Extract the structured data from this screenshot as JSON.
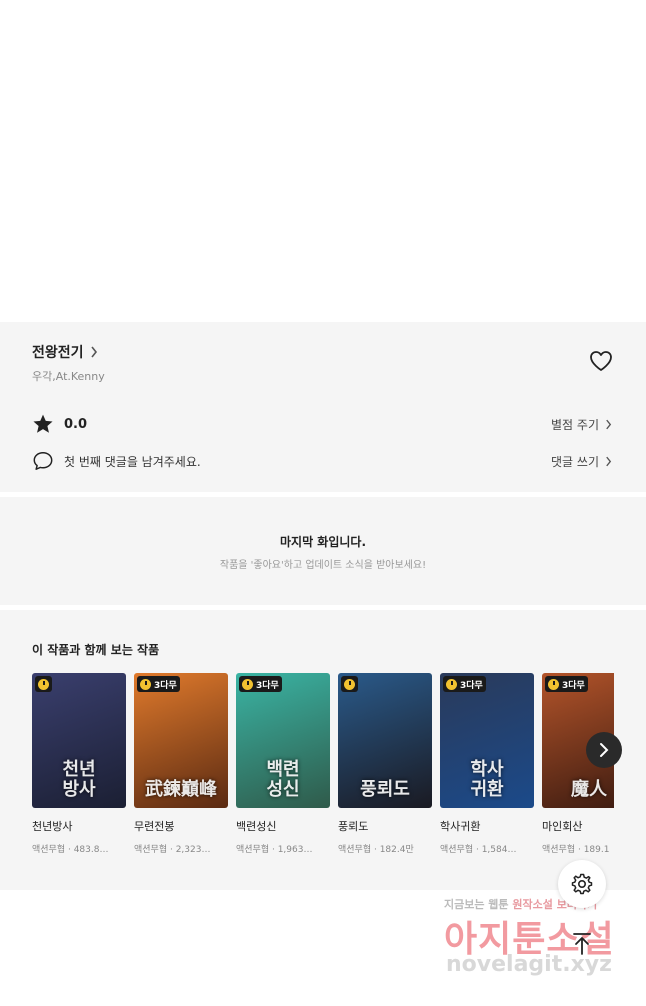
{
  "work": {
    "title": "전왕전기",
    "author": "우각,At.Kenny",
    "rating": "0.0",
    "rate_label": "별점 주기",
    "comment_prompt": "첫 번째 댓글을 남겨주세요.",
    "comment_label": "댓글 쓰기"
  },
  "last_episode": {
    "title": "마지막 화입니다.",
    "subtitle": "작품을 '좋아요'하고 업데이트 소식을 받아보세요!"
  },
  "recommend": {
    "title": "이 작품과 함께 보는 작품",
    "cards": [
      {
        "title": "천년방사",
        "meta": "액션무협 · 483.8…",
        "badge": "",
        "art": "천년\n방사",
        "colors": [
          "#3a3f6e",
          "#1b1f33"
        ]
      },
      {
        "title": "무련전봉",
        "meta": "액션무협 · 2,323…",
        "badge": "3다무",
        "art": "武鍊巔峰",
        "colors": [
          "#e07a2c",
          "#5a2a12"
        ]
      },
      {
        "title": "백련성신",
        "meta": "액션무협 · 1,963…",
        "badge": "3다무",
        "art": "백련\n성신",
        "colors": [
          "#3ab4a4",
          "#2f5a4a"
        ]
      },
      {
        "title": "풍뢰도",
        "meta": "액션무협 · 182.4만",
        "badge": "",
        "art": "풍뢰도",
        "colors": [
          "#2a5a8a",
          "#1a1a22"
        ]
      },
      {
        "title": "학사귀환",
        "meta": "액션무협 · 1,584…",
        "badge": "3다무",
        "art": "학사\n귀환",
        "colors": [
          "#2a3a5a",
          "#1b4a8a"
        ]
      },
      {
        "title": "마인회산",
        "meta": "액션무협 · 189.1",
        "badge": "3다무",
        "art": "魔人",
        "colors": [
          "#b3542a",
          "#3a1a10"
        ]
      }
    ]
  },
  "icons": {
    "chevron": "chevron-right-icon",
    "heart": "heart-icon",
    "star": "star-icon",
    "comment": "comment-icon",
    "next": "arrow-right-icon",
    "settings": "gear-icon",
    "top": "arrow-up-icon"
  },
  "watermark": {
    "line1_a": "지금보는 웹툰",
    "line1_b": "원작소설",
    "line1_c": "보러가기",
    "line2": "아지툰소설",
    "line3": "novelagit.xyz"
  }
}
